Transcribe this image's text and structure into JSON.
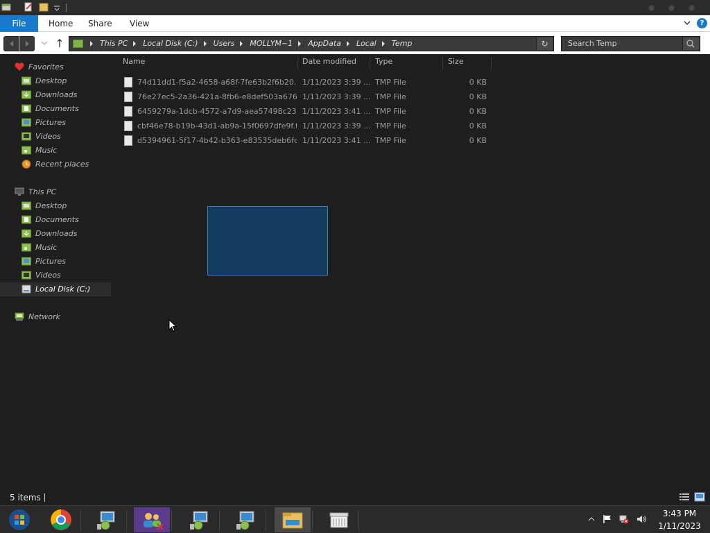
{
  "ribbon": {
    "file": "File",
    "home": "Home",
    "share": "Share",
    "view": "View",
    "help": "?"
  },
  "address": {
    "crumbs": [
      "This PC",
      "Local Disk (C:)",
      "Users",
      "MOLLYM~1",
      "AppData",
      "Local",
      "Temp"
    ]
  },
  "search": {
    "placeholder": "Search Temp"
  },
  "sidebar": {
    "favorites": "Favorites",
    "fav_items": [
      "Desktop",
      "Downloads",
      "Documents",
      "Pictures",
      "Videos",
      "Music",
      "Recent places"
    ],
    "thispc": "This PC",
    "pc_items": [
      "Desktop",
      "Documents",
      "Downloads",
      "Music",
      "Pictures",
      "Videos",
      "Local Disk (C:)"
    ],
    "network": "Network"
  },
  "columns": {
    "name": "Name",
    "date": "Date modified",
    "type": "Type",
    "size": "Size"
  },
  "files": [
    {
      "name": "74d11dd1-f5a2-4658-a68f-7fe63b2f6b20.t...",
      "date": "1/11/2023 3:39 ...",
      "type": "TMP File",
      "size": "0 KB"
    },
    {
      "name": "76e27ec5-2a36-421a-8fb6-e8def503a676....",
      "date": "1/11/2023 3:39 ...",
      "type": "TMP File",
      "size": "0 KB"
    },
    {
      "name": "6459279a-1dcb-4572-a7d9-aea57498c238...",
      "date": "1/11/2023 3:41 ...",
      "type": "TMP File",
      "size": "0 KB"
    },
    {
      "name": "cbf46e78-b19b-43d1-ab9a-15f0697dfe9f.t...",
      "date": "1/11/2023 3:39 ...",
      "type": "TMP File",
      "size": "0 KB"
    },
    {
      "name": "d5394961-5f17-4b42-b363-e83535deb6fc....",
      "date": "1/11/2023 3:41 ...",
      "type": "TMP File",
      "size": "0 KB"
    }
  ],
  "status": {
    "items": "5 items"
  },
  "taskbar": {
    "time": "3:43 PM",
    "date": "1/11/2023"
  },
  "colors": {
    "accent": "#1979ca",
    "background": "#1e1e1e",
    "selection": "#143a5e"
  },
  "icons": {
    "favorites": "heart-icon",
    "folder": "folder-icon",
    "recent": "recent-places-icon",
    "computer": "monitor-icon",
    "drive": "drive-icon",
    "network": "network-icon",
    "file": "file-icon"
  }
}
